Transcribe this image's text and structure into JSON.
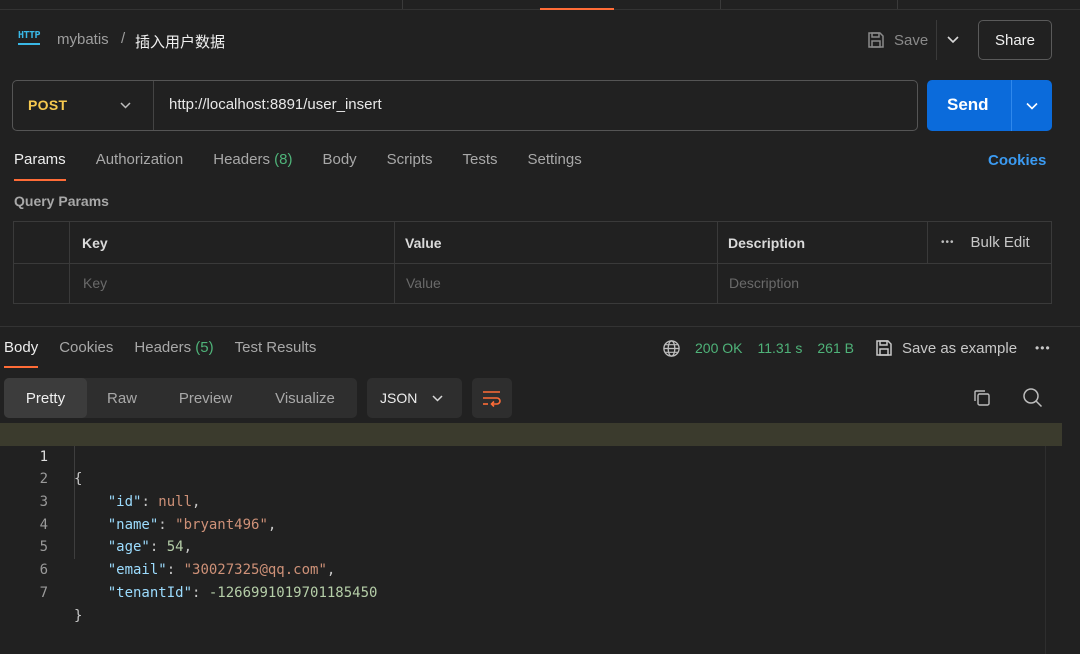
{
  "header": {
    "icon_text": "HTTP",
    "breadcrumb_parent": "mybatis",
    "breadcrumb_sep": "/",
    "breadcrumb_current": "插入用户数据",
    "save_label": "Save",
    "share_label": "Share"
  },
  "request": {
    "method": "POST",
    "url": "http://localhost:8891/user_insert",
    "send_label": "Send"
  },
  "request_tabs": [
    {
      "label": "Params",
      "active": true
    },
    {
      "label": "Authorization"
    },
    {
      "label": "Headers ",
      "count": "(8)"
    },
    {
      "label": "Body"
    },
    {
      "label": "Scripts"
    },
    {
      "label": "Tests"
    },
    {
      "label": "Settings"
    }
  ],
  "cookies_link": "Cookies",
  "query_params": {
    "title": "Query Params",
    "columns": [
      "Key",
      "Value",
      "Description"
    ],
    "bulk_edit": "Bulk Edit",
    "placeholders": [
      "Key",
      "Value",
      "Description"
    ]
  },
  "response_tabs": [
    {
      "label": "Body",
      "active": true
    },
    {
      "label": "Cookies"
    },
    {
      "label": "Headers ",
      "count": "(5)"
    },
    {
      "label": "Test Results"
    }
  ],
  "response_status": {
    "status": "200 OK",
    "time": "11.31 s",
    "size": "261 B",
    "save_example": "Save as example",
    "more": "•••"
  },
  "view_modes": [
    "Pretty",
    "Raw",
    "Preview",
    "Visualize"
  ],
  "format_select": "JSON",
  "code": {
    "line_numbers": [
      "1",
      "2",
      "3",
      "4",
      "5",
      "6",
      "7"
    ],
    "open_brace": "{",
    "close_brace": "}",
    "fields": [
      {
        "key": "\"id\"",
        "value": "null",
        "type": "kw",
        "comma": true
      },
      {
        "key": "\"name\"",
        "value": "\"bryant496\"",
        "type": "s",
        "comma": true
      },
      {
        "key": "\"age\"",
        "value": "54",
        "type": "n",
        "comma": true
      },
      {
        "key": "\"email\"",
        "value": "\"30027325@qq.com\"",
        "type": "s",
        "comma": true
      },
      {
        "key": "\"tenantId\"",
        "value": "-1266991019701185450",
        "type": "n",
        "comma": false
      }
    ]
  },
  "colors": {
    "accent": "#ff6c37",
    "send": "#0b6bdb",
    "method": "#f6c94f",
    "success": "#4fb379",
    "link": "#3b9bf2"
  }
}
